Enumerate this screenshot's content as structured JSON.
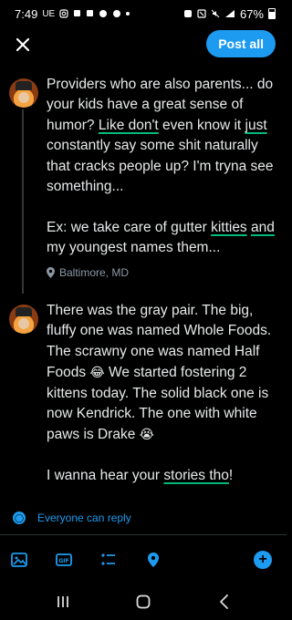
{
  "status_bar": {
    "time": "7:49",
    "left_icons": [
      "UE",
      "instagram-icon",
      "message-icon",
      "message-icon",
      "pinterest-icon",
      "pinterest-icon",
      "dot"
    ],
    "right_icons": [
      "alarm-icon",
      "nfc-icon",
      "mute-icon",
      "signal-icon"
    ],
    "battery": "67%"
  },
  "compose": {
    "post_all_label": "Post all"
  },
  "posts": [
    {
      "paragraphs": [
        {
          "parts": [
            {
              "text": "Providers who are also parents... do your kids have a great sense of humor? "
            },
            {
              "text": "Like don't",
              "u": true
            },
            {
              "text": " even know it "
            },
            {
              "text": "just",
              "u": true
            },
            {
              "text": " constantly say some shit naturally that cracks people up? I'm tryna see something..."
            }
          ]
        },
        {
          "parts": [
            {
              "text": "Ex: we take care of gutter "
            },
            {
              "text": "kitties",
              "u": true
            },
            {
              "text": " "
            },
            {
              "text": "and",
              "u": true
            },
            {
              "text": " my youngest names them..."
            }
          ]
        }
      ],
      "location": "Baltimore, MD"
    },
    {
      "paragraphs": [
        {
          "parts": [
            {
              "text": "There was the gray pair. The big, fluffy one was named Whole Foods. The scrawny one was named Half Foods "
            },
            {
              "text": "😂",
              "emoji": true
            },
            {
              "text": " We started fostering 2 kittens today. The solid black one is now Kendrick. The one with white paws is Drake "
            },
            {
              "text": "😭",
              "emoji": true
            }
          ]
        },
        {
          "parts": [
            {
              "text": "I wanna hear your "
            },
            {
              "text": "stories tho",
              "u": true
            },
            {
              "text": "!"
            }
          ]
        }
      ]
    }
  ],
  "reply_setting": {
    "label": "Everyone can reply"
  },
  "composer_tools": [
    "image-icon",
    "gif-icon",
    "poll-icon",
    "location-icon",
    "add-post-icon"
  ],
  "colors": {
    "accent": "#1d9bf0",
    "spellcheck_underline": "#00ba7c",
    "background": "#000000",
    "text": "#e7e9ea"
  }
}
